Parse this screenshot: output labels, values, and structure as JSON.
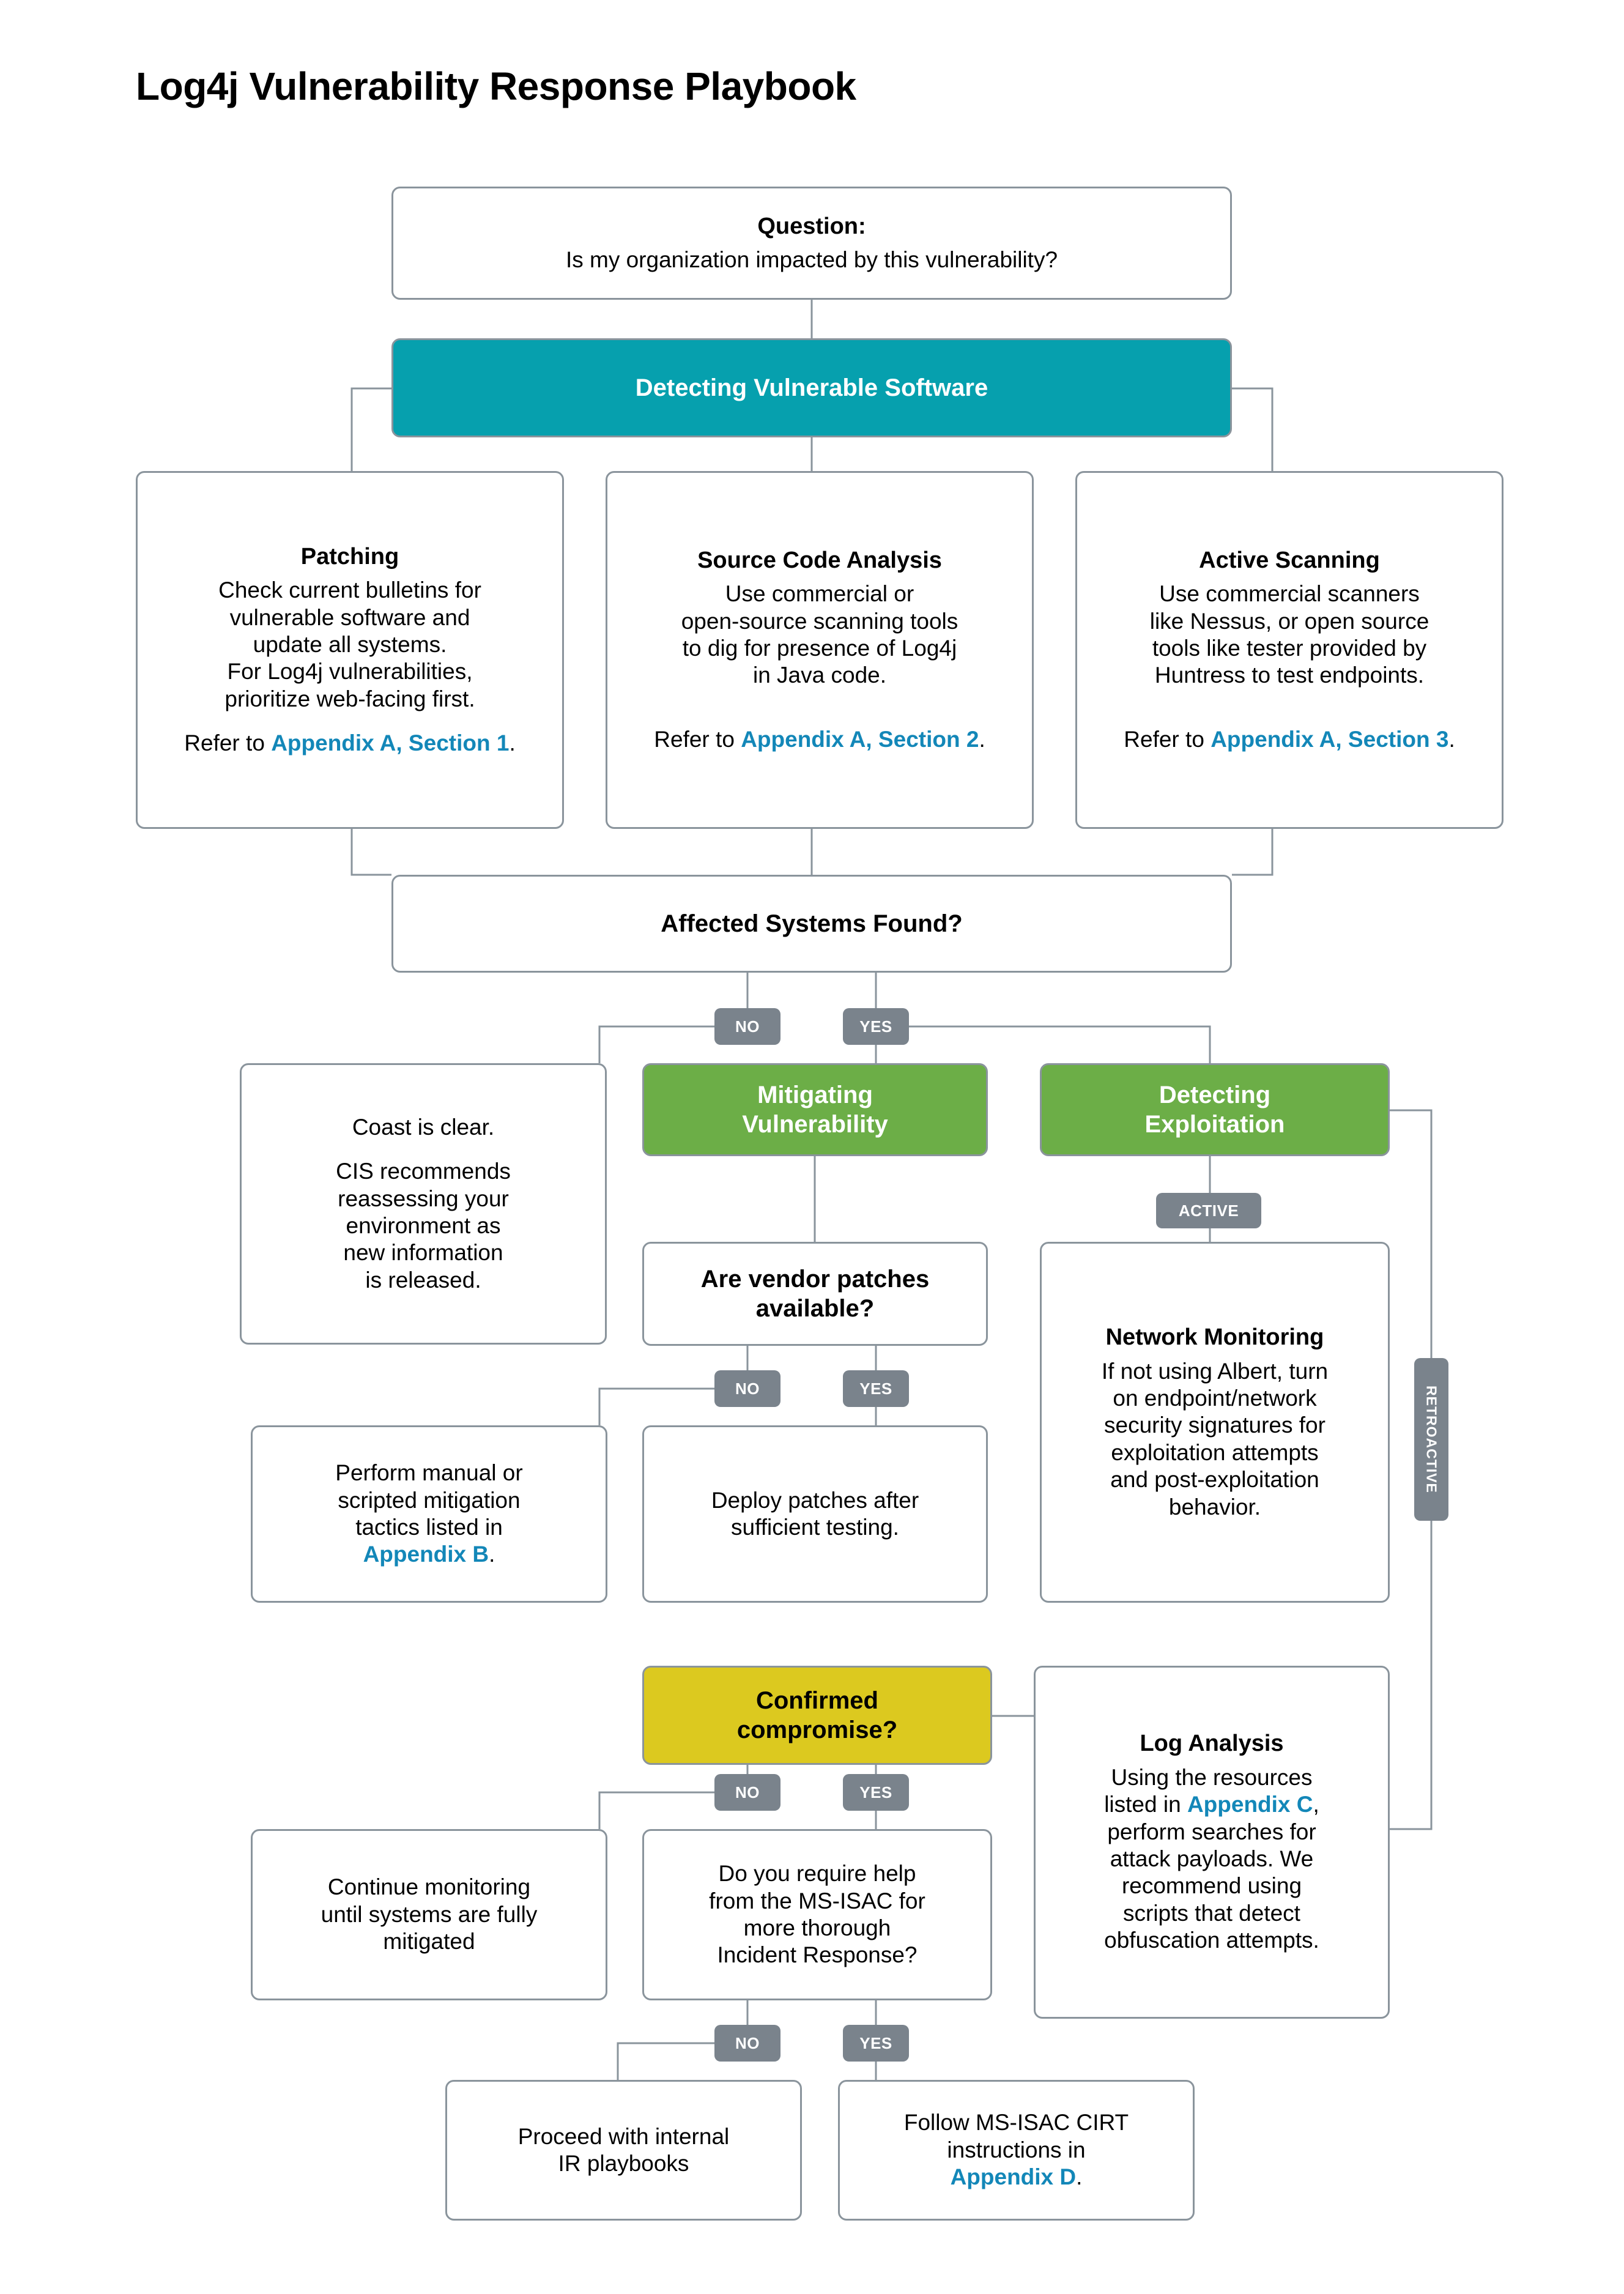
{
  "page": {
    "title": "Log4j Vulnerability Response Playbook"
  },
  "colors": {
    "teal": "#06A0AE",
    "green": "#6CAE47",
    "yellow": "#DCC91F",
    "badge_gray": "#7A838C",
    "link_blue": "#1387B8",
    "border_gray": "#8A949C"
  },
  "nodes": {
    "question": {
      "heading": "Question:",
      "body": "Is my organization impacted by this vulnerability?"
    },
    "detecting_vulnerable_software": {
      "label": "Detecting Vulnerable Software"
    },
    "patching": {
      "heading": "Patching",
      "body_line1": "Check current bulletins for",
      "body_line2": "vulnerable software and",
      "body_line3": "update all systems.",
      "body_line4": "For Log4j vulnerabilities,",
      "body_line5": "prioritize web-facing first.",
      "refer_prefix": "Refer to ",
      "refer_link": "Appendix A, Section 1",
      "refer_suffix": "."
    },
    "source_code_analysis": {
      "heading": "Source Code Analysis",
      "body_line1": "Use commercial or",
      "body_line2": "open-source scanning tools",
      "body_line3": "to dig for presence of Log4j",
      "body_line4": "in Java code.",
      "refer_prefix": "Refer to ",
      "refer_link": "Appendix A, Section 2",
      "refer_suffix": "."
    },
    "active_scanning": {
      "heading": "Active Scanning",
      "body_line1": "Use commercial scanners",
      "body_line2": "like Nessus, or open source",
      "body_line3": "tools like tester provided by",
      "body_line4": "Huntress to test endpoints.",
      "refer_prefix": "Refer to ",
      "refer_link": "Appendix A, Section 3",
      "refer_suffix": "."
    },
    "affected_systems_found": {
      "label": "Affected Systems Found?"
    },
    "coast_is_clear": {
      "line1": "Coast is clear.",
      "line2": "CIS recommends",
      "line3": "reassessing your",
      "line4": "environment as",
      "line5": "new information",
      "line6": "is released."
    },
    "mitigating_vulnerability": {
      "label_line1": "Mitigating",
      "label_line2": "Vulnerability"
    },
    "detecting_exploitation": {
      "label_line1": "Detecting",
      "label_line2": "Exploitation"
    },
    "vendor_patches": {
      "label_line1": "Are vendor patches",
      "label_line2": "available?"
    },
    "network_monitoring": {
      "heading": "Network Monitoring",
      "body_line1": "If not using Albert, turn",
      "body_line2": "on endpoint/network",
      "body_line3": "security signatures for",
      "body_line4": "exploitation attempts",
      "body_line5": "and post-exploitation",
      "body_line6": "behavior."
    },
    "manual_mitigation": {
      "line1": "Perform manual or",
      "line2": "scripted mitigation",
      "line3": "tactics listed in",
      "link": "Appendix B",
      "suffix": "."
    },
    "deploy_patches": {
      "line1": "Deploy patches after",
      "line2": "sufficient testing."
    },
    "confirmed_compromise": {
      "label_line1": "Confirmed",
      "label_line2": "compromise?"
    },
    "log_analysis": {
      "heading": "Log Analysis",
      "body_line1": "Using the resources",
      "body_line2_prefix": "listed in ",
      "body_line2_link": "Appendix C",
      "body_line2_suffix": ",",
      "body_line3": "perform searches for",
      "body_line4": "attack payloads. We",
      "body_line5": "recommend using",
      "body_line6": "scripts that detect",
      "body_line7": "obfuscation attempts."
    },
    "continue_monitoring": {
      "line1": "Continue monitoring",
      "line2": "until systems are fully",
      "line3": "mitigated"
    },
    "require_help": {
      "line1": "Do you require help",
      "line2": "from the MS-ISAC for",
      "line3": "more thorough",
      "line4": "Incident Response?"
    },
    "internal_ir": {
      "line1": "Proceed with internal",
      "line2": "IR playbooks"
    },
    "follow_cirt": {
      "line1": "Follow MS-ISAC CIRT",
      "line2": "instructions in",
      "link": "Appendix D",
      "suffix": "."
    }
  },
  "badges": {
    "affected_no": "NO",
    "affected_yes": "YES",
    "active": "ACTIVE",
    "retroactive": "RETROACTIVE",
    "vendor_no": "NO",
    "vendor_yes": "YES",
    "compromise_no": "NO",
    "compromise_yes": "YES",
    "help_no": "NO",
    "help_yes": "YES"
  }
}
